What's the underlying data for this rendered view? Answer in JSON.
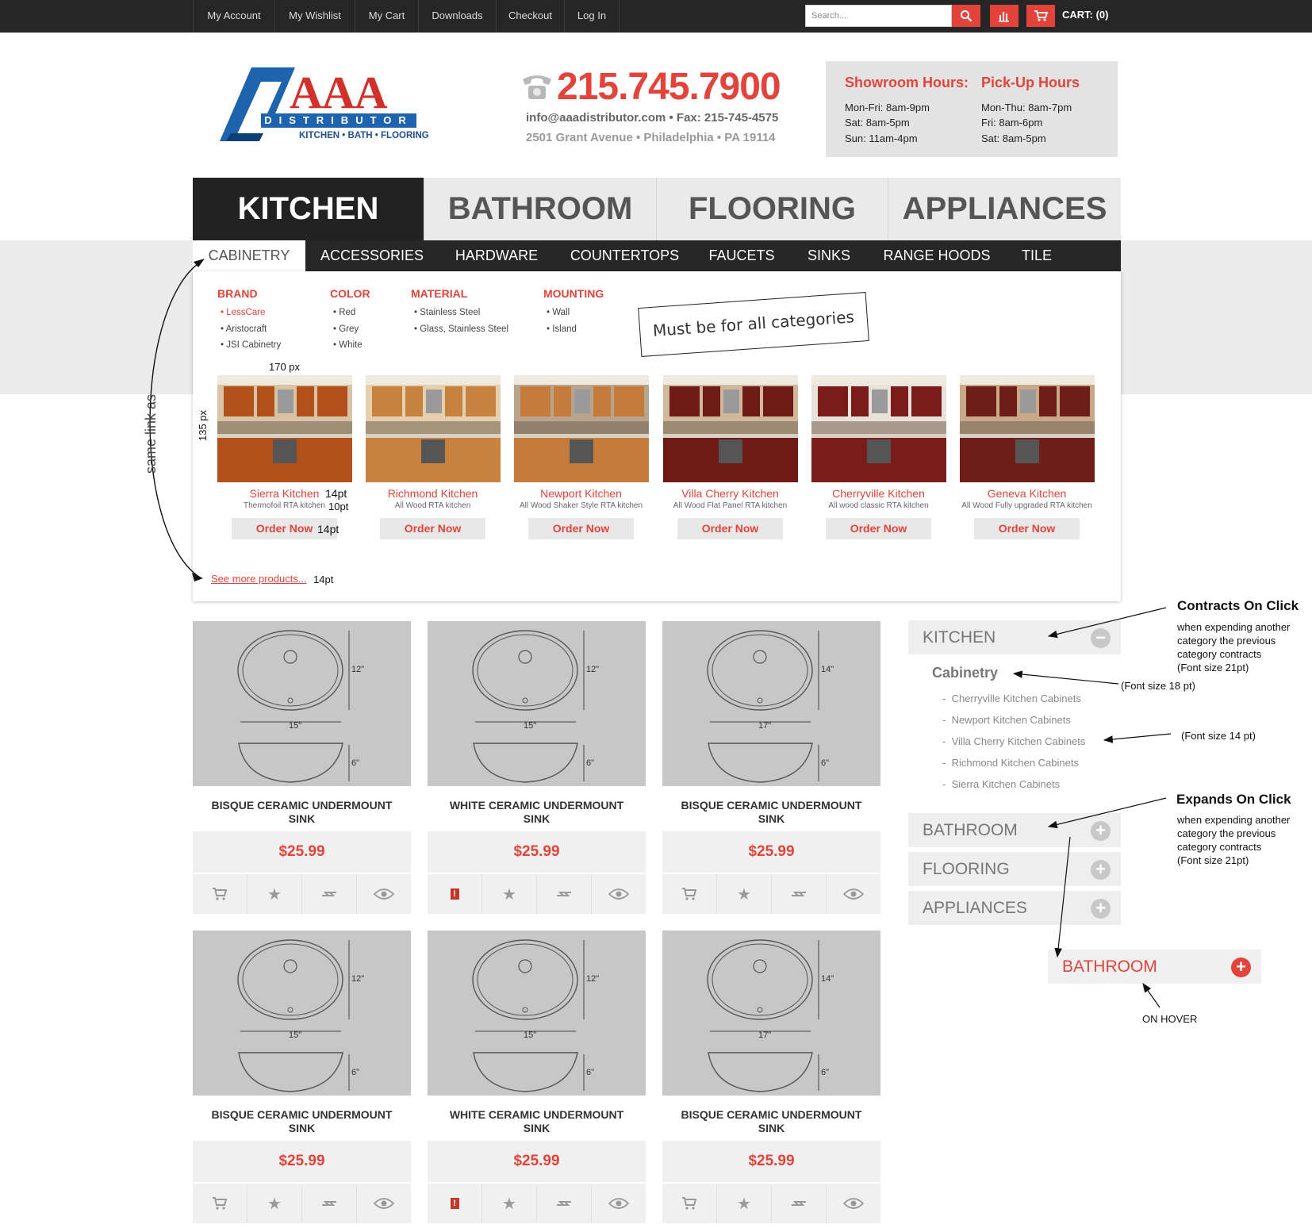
{
  "topbar": {
    "links": [
      "My Account",
      "My Wishlist",
      "My Cart",
      "Downloads",
      "Checkout",
      "Log In"
    ],
    "search_placeholder": "Search...",
    "cart_label": "CART: (0)"
  },
  "header": {
    "logo_main": "AAA",
    "logo_sub": "DISTRIBUTOR",
    "logo_tagline": "KITCHEN • BATH • FLOORING",
    "phone": "215.745.7900",
    "email_fax": "info@aaadistributor.com • Fax: 215-745-4575",
    "address": "2501 Grant Avenue • Philadelphia • PA 19114",
    "showroom_title": "Showroom Hours:",
    "showroom_lines": [
      "Mon-Fri: 8am-9pm",
      "Sat: 8am-5pm",
      "Sun: 11am-4pm"
    ],
    "pickup_title": "Pick-Up Hours",
    "pickup_lines": [
      "Mon-Thu: 8am-7pm",
      "Fri: 8am-6pm",
      "Sat: 8am-5pm"
    ]
  },
  "main_tabs": [
    "KITCHEN",
    "BATHROOM",
    "FLOORING",
    "APPLIANCES"
  ],
  "sub_nav": [
    "CABINETRY",
    "ACCESSORIES",
    "HARDWARE",
    "COUNTERTOPS",
    "FAUCETS",
    "SINKS",
    "RANGE HOODS",
    "TILE"
  ],
  "filters": {
    "brand": {
      "title": "BRAND",
      "items": [
        "• LessCare",
        "• Aristocraft",
        "• JSI Cabinetry"
      ]
    },
    "color": {
      "title": "COLOR",
      "items": [
        "• Red",
        "• Grey",
        "• White"
      ]
    },
    "material": {
      "title": "MATERIAL",
      "items": [
        "• Stainless Steel",
        "• Glass, Stainless Steel"
      ]
    },
    "mounting": {
      "title": "MOUNTING",
      "items": [
        "• Wall",
        "• Island"
      ]
    }
  },
  "annotations": {
    "note": "Must be for all categories",
    "px170": "170 px",
    "px135": "135 px",
    "pt14a": "14pt",
    "pt10": "10pt",
    "pt14b": "14pt",
    "pt14c": "14pt",
    "same_link": "same link as",
    "contracts_title": "Contracts On Click",
    "contracts_lines": [
      "when expending another",
      "category the previous",
      "category contracts",
      "(Font size 21pt)"
    ],
    "font18": "(Font size 18 pt)",
    "font14": "(Font size 14 pt)",
    "expands_title": "Expands On Click",
    "expands_lines": [
      "when expending another",
      "category the previous",
      "category contracts",
      "(Font size 21pt)"
    ],
    "on_hover": "ON HOVER"
  },
  "featured_products": [
    {
      "name": "Sierra Kitchen",
      "sub": "Thermofoil RTA kitchen",
      "btn": "Order Now",
      "cab": "#b2501c",
      "wall": "#d9c3a5"
    },
    {
      "name": "Richmond Kitchen",
      "sub": "All Wood RTA kitchen",
      "btn": "Order Now",
      "cab": "#c8823f",
      "wall": "#e6cfae"
    },
    {
      "name": "Newport Kitchen",
      "sub": "All Wood Shaker Style RTA kitchen",
      "btn": "Order Now",
      "cab": "#c47b3c",
      "wall": "#b8a48c"
    },
    {
      "name": "Villa Cherry Kitchen",
      "sub": "All Wood Flat Panel RTA kitchen",
      "btn": "Order Now",
      "cab": "#6e1b16",
      "wall": "#cfb99a"
    },
    {
      "name": "Cherryville Kitchen",
      "sub": "All wood classic RTA kitchen",
      "btn": "Order Now",
      "cab": "#7a1c1a",
      "wall": "#e8e2da"
    },
    {
      "name": "Geneva Kitchen",
      "sub": "All Wood Fully upgraded RTA kitchen",
      "btn": "Order Now",
      "cab": "#6f1d18",
      "wall": "#c7a988"
    }
  ],
  "see_more": "See more products...",
  "products": [
    {
      "title": "BISQUE CERAMIC UNDERMOUNT SINK",
      "price": "$25.99",
      "w": "15\"",
      "h": "12\"",
      "d": "6\"",
      "alt": false
    },
    {
      "title": "WHITE CERAMIC UNDERMOUNT SINK",
      "price": "$25.99",
      "w": "15\"",
      "h": "12\"",
      "d": "6\"",
      "alt": true
    },
    {
      "title": "BISQUE CERAMIC UNDERMOUNT SINK",
      "price": "$25.99",
      "w": "17\"",
      "h": "14\"",
      "d": "6\"",
      "alt": false
    },
    {
      "title": "BISQUE CERAMIC UNDERMOUNT SINK",
      "price": "$25.99",
      "w": "15\"",
      "h": "12\"",
      "d": "6\"",
      "alt": false
    },
    {
      "title": "WHITE CERAMIC UNDERMOUNT SINK",
      "price": "$25.99",
      "w": "15\"",
      "h": "12\"",
      "d": "6\"",
      "alt": true
    },
    {
      "title": "BISQUE CERAMIC UNDERMOUNT SINK",
      "price": "$25.99",
      "w": "17\"",
      "h": "14\"",
      "d": "6\"",
      "alt": false
    }
  ],
  "sidebar": {
    "kitchen": "KITCHEN",
    "cabinetry": "Cabinetry",
    "links": [
      "Cherryville Kitchen Cabinets",
      "Newport Kitchen Cabinets",
      "Villa Cherry Kitchen Cabinets",
      "Richmond Kitchen Cabinets",
      "Sierra Kitchen Cabinets"
    ],
    "bathroom": "BATHROOM",
    "flooring": "FLOORING",
    "appliances": "APPLIANCES",
    "hover_bathroom": "BATHROOM"
  },
  "colors": {
    "accent": "#e2443b",
    "dark": "#262626",
    "panel_gray": "#ebebeb"
  }
}
